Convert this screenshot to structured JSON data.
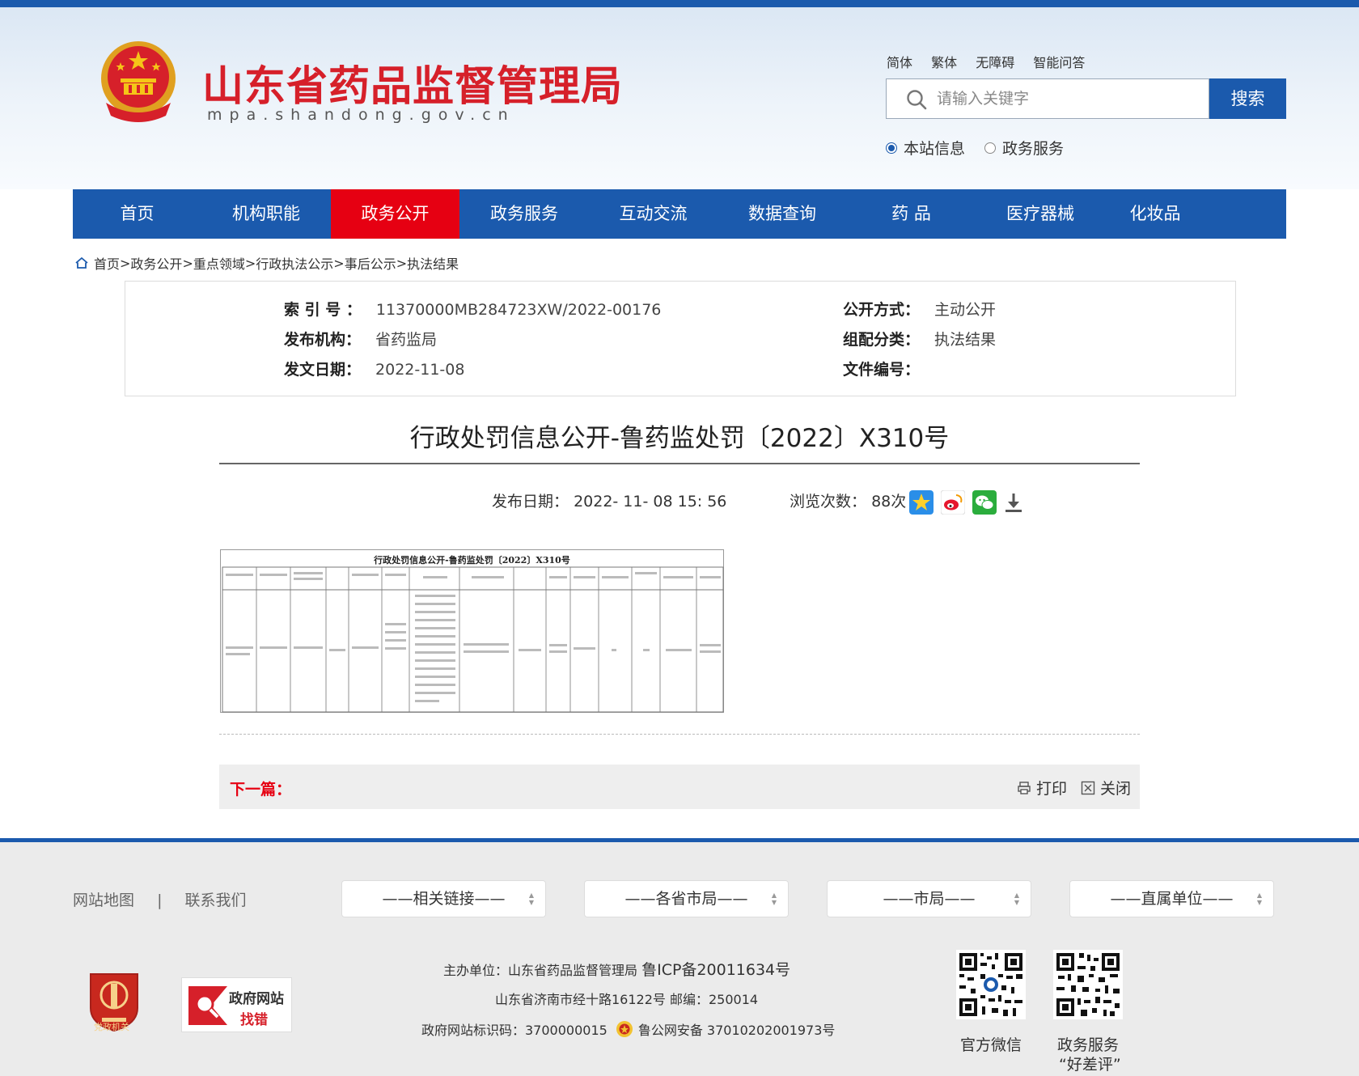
{
  "header": {
    "site_title": "山东省药品监督管理局",
    "site_domain": "mpa.shandong.gov.cn",
    "top_links": [
      "简体",
      "繁体",
      "无障碍",
      "智能问答"
    ],
    "search_placeholder": "请输入关键字",
    "search_button": "搜索",
    "scope_options": [
      "本站信息",
      "政务服务"
    ],
    "scope_selected": "本站信息"
  },
  "nav": {
    "items": [
      "首页",
      "机构职能",
      "政务公开",
      "政务服务",
      "互动交流",
      "数据查询",
      "药 品",
      "医疗器械",
      "化妆品"
    ],
    "active": "政务公开"
  },
  "breadcrumb": {
    "items": [
      "首页",
      "政务公开",
      "重点领域",
      "行政执法公示",
      "事后公示",
      "执法结果"
    ]
  },
  "meta": {
    "index_label": "索 引 号 ：",
    "index_value": "11370000MB284723XW/2022-00176",
    "publisher_label": "发布机构：",
    "publisher_value": "省药监局",
    "date_label": "发文日期：",
    "date_value": "2022-11-08",
    "method_label": "公开方式：",
    "method_value": "主动公开",
    "category_label": "组配分类：",
    "category_value": "执法结果",
    "docno_label": "文件编号："
  },
  "article": {
    "title": "行政处罚信息公开-鲁药监处罚〔2022〕X310号",
    "publish_label": "发布日期：",
    "publish_time": "2022- 11- 08 15: 56",
    "views_label": "浏览次数：",
    "views_value": "88次",
    "image_title": "行政处罚信息公开-鲁药监处罚〔2022〕X310号",
    "share_icons": [
      "favorite-star-icon",
      "weibo-icon",
      "wechat-icon",
      "download-icon"
    ]
  },
  "bottom_bar": {
    "next_label": "下一篇：",
    "print_label": "打印",
    "close_label": "关闭"
  },
  "footer": {
    "links": [
      "网站地图",
      "联系我们"
    ],
    "separator": "|",
    "selects": [
      "——相关链接——",
      "——各省市局——",
      "——市局——",
      "——直属单位——"
    ],
    "sponsor": "主办单位：山东省药品监督管理局",
    "icp": "鲁ICP备20011634号",
    "address": "山东省济南市经十路16122号 邮编：250014",
    "site_code": "政府网站标识码：3700000015",
    "police": "鲁公网安备 37010202001973号",
    "badge2_top": "政府网站",
    "badge2_bottom": "找错",
    "badge1_text": "党政机关",
    "qr1_label": "官方微信",
    "qr2_label_1": "政务服务",
    "qr2_label_2": "“好差评”"
  },
  "colors": {
    "primary_blue": "#1b5aad",
    "active_red": "#e60012",
    "title_red": "#d6202a"
  }
}
